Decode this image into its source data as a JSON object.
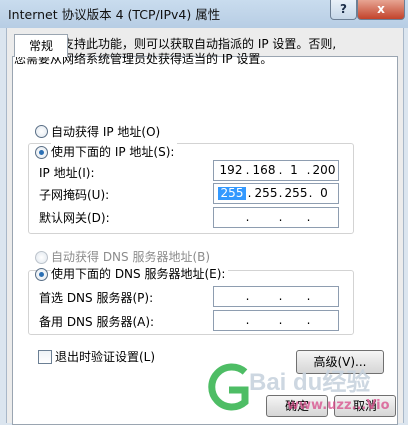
{
  "window": {
    "title": "Internet 协议版本 4 (TCP/IPv4) 属性",
    "help_label": "?",
    "close_label": "x"
  },
  "tabs": [
    {
      "label": "常规"
    }
  ],
  "general": {
    "description_line1": "如果网络支持此功能，则可以获取自动指派的 IP 设置。否则,",
    "description_line2": "您需要从网络系统管理员处获得适当的 IP 设置。",
    "auto_ip": {
      "label": "自动获得 IP 地址(O)",
      "selected": false
    },
    "manual_ip": {
      "label": "使用下面的 IP 地址(S):",
      "selected": true
    },
    "ip_address": {
      "label": "IP 地址(I):",
      "octets": [
        "192",
        "168",
        "1",
        "200"
      ]
    },
    "subnet_mask": {
      "label": "子网掩码(U):",
      "octets": [
        "255",
        "255",
        "255",
        "0"
      ]
    },
    "gateway": {
      "label": "默认网关(D):",
      "octets": [
        "",
        "",
        "",
        ""
      ]
    },
    "auto_dns": {
      "label": "自动获得 DNS 服务器地址(B)",
      "selected": false,
      "enabled": false
    },
    "manual_dns": {
      "label": "使用下面的 DNS 服务器地址(E):",
      "selected": true
    },
    "preferred_dns": {
      "label": "首选 DNS 服务器(P):",
      "octets": [
        "",
        "",
        "",
        ""
      ]
    },
    "alternate_dns": {
      "label": "备用 DNS 服务器(A):",
      "octets": [
        "",
        "",
        "",
        ""
      ]
    },
    "validate_on_exit": {
      "label": "退出时验证设置(L)",
      "checked": false
    },
    "advanced_label": "高级(V)...",
    "ok_label": "确定",
    "cancel_label": "取消"
  },
  "watermark": {
    "text": "Bai du经验",
    "sub": "www.uzz...Vio"
  }
}
